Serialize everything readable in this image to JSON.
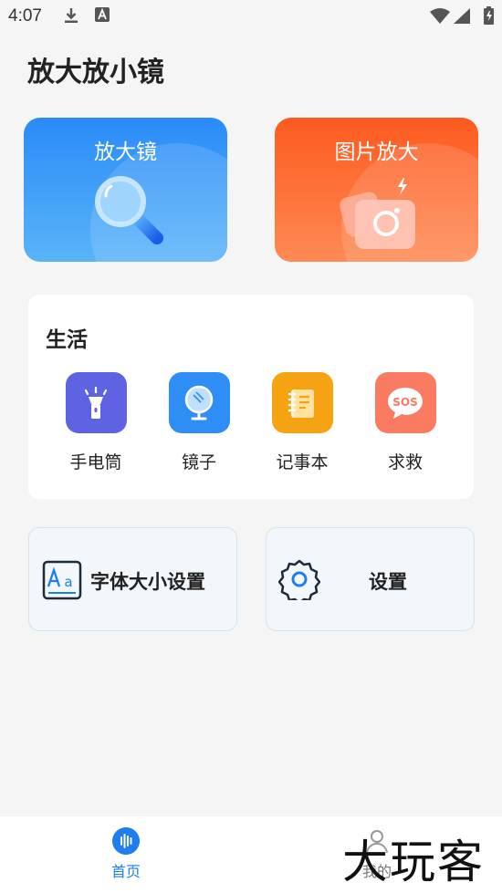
{
  "status_bar": {
    "time": "4:07",
    "icons": [
      "download-icon",
      "font-notification-icon",
      "wifi-icon",
      "signal-icon",
      "battery-icon"
    ]
  },
  "app": {
    "title": "放大放小镜"
  },
  "feature_cards": [
    {
      "label": "放大镜",
      "icon": "magnifier-icon",
      "color": "#2a8bf8"
    },
    {
      "label": "图片放大",
      "icon": "photo-camera-icon",
      "color": "#fd5a1f"
    }
  ],
  "life": {
    "heading": "生活",
    "tools": [
      {
        "label": "手电筒",
        "icon": "flashlight-icon",
        "color": "#5d63e3"
      },
      {
        "label": "镜子",
        "icon": "mirror-icon",
        "color": "#2f8ef6"
      },
      {
        "label": "记事本",
        "icon": "notebook-icon",
        "color": "#f5a312"
      },
      {
        "label": "求救",
        "icon": "sos-icon",
        "color": "#fa7b62"
      }
    ]
  },
  "settings": [
    {
      "label": "字体大小设置",
      "icon": "font-size-icon"
    },
    {
      "label": "设置",
      "icon": "gear-icon"
    }
  ],
  "tabbar": {
    "tabs": [
      {
        "label": "首页",
        "icon": "home-icon",
        "active": true,
        "color": "#1e7ef0"
      },
      {
        "label": "我的",
        "icon": "profile-icon",
        "active": false
      }
    ]
  },
  "watermark": {
    "text": "大玩客"
  }
}
